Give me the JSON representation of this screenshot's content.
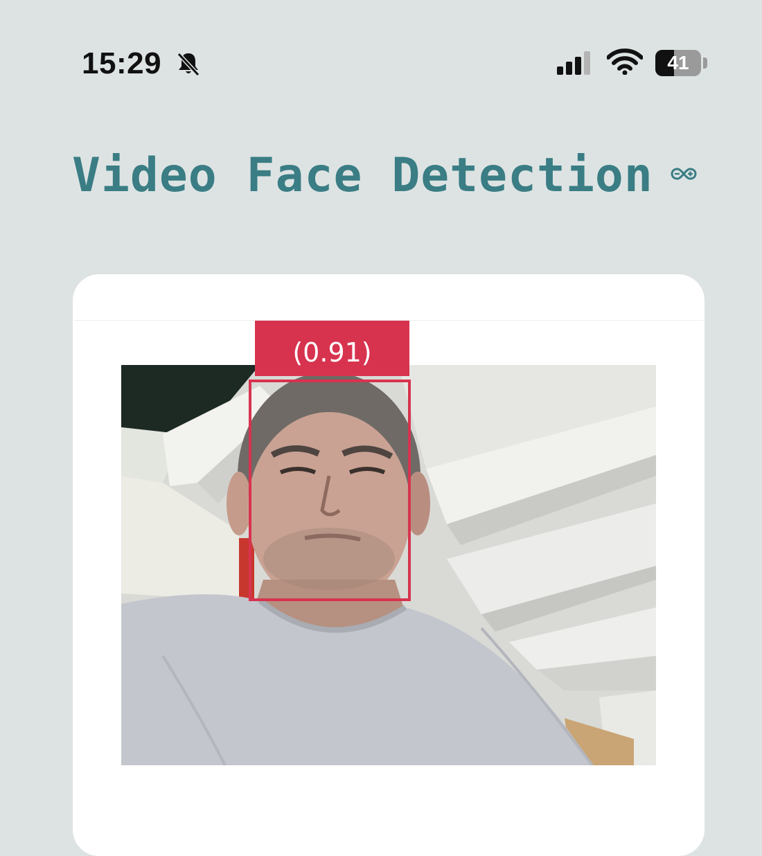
{
  "status_bar": {
    "time": "15:29",
    "battery_level": "41",
    "icons": [
      "bell-slash-icon",
      "cellular-signal-icon",
      "wifi-icon",
      "battery-icon"
    ]
  },
  "header": {
    "title": "Video Face Detection",
    "logo_icon": "infinity-icon"
  },
  "detection": {
    "confidence_label": "(0.91)",
    "box_color": "#d7334f"
  },
  "colors": {
    "background": "#dde3e3",
    "title": "#3a7d84",
    "card": "#ffffff",
    "accent": "#d7334f"
  }
}
